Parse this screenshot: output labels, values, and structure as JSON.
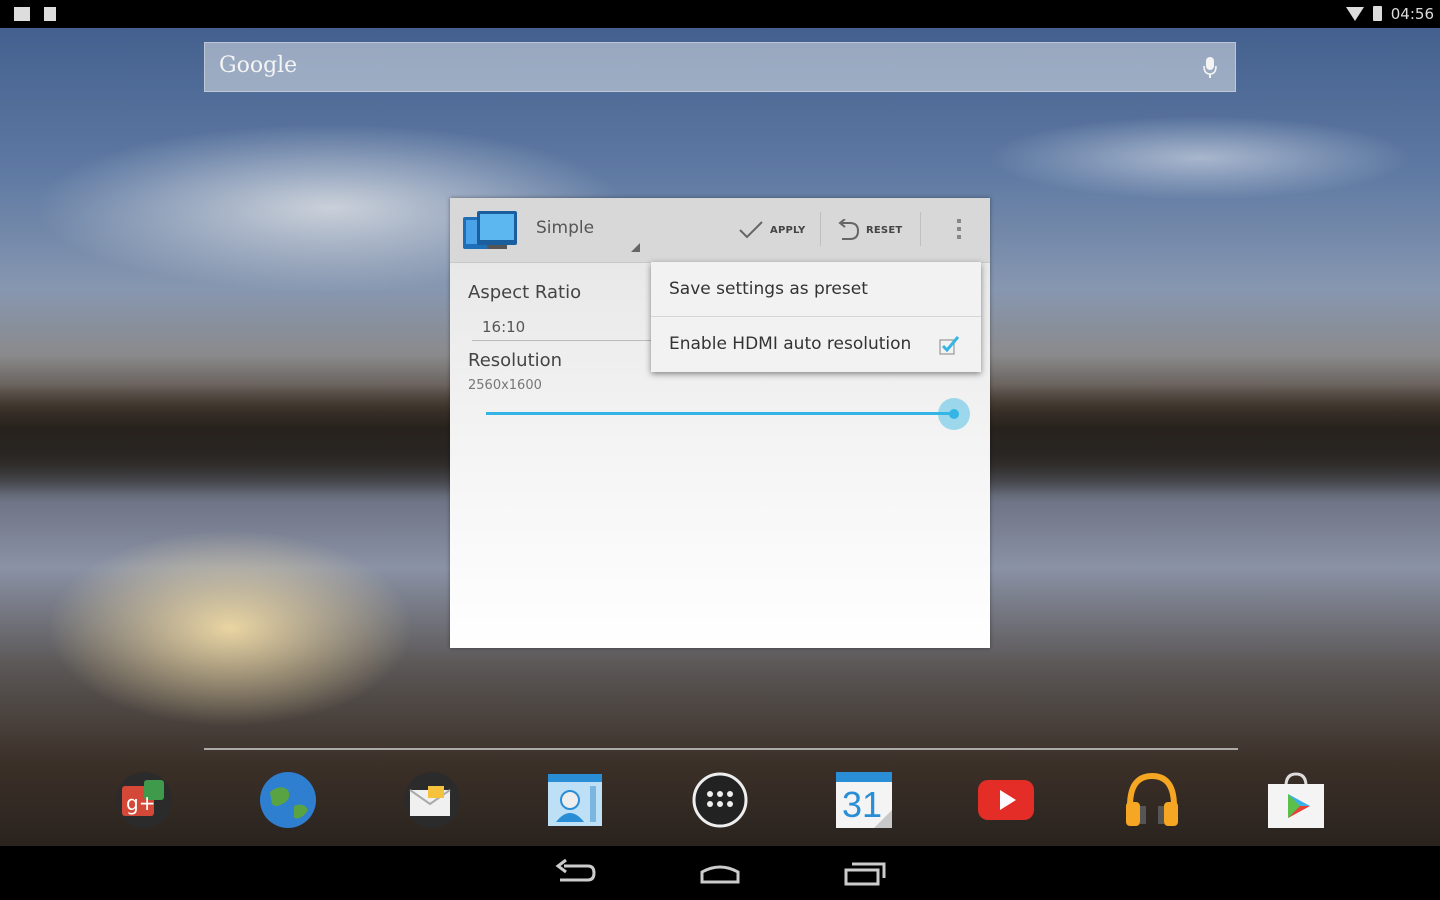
{
  "status_bar": {
    "time": "04:56"
  },
  "search": {
    "brand": "Google"
  },
  "widget": {
    "mode": "Simple",
    "apply_label": "APPLY",
    "reset_label": "RESET",
    "aspect_ratio_label": "Aspect Ratio",
    "aspect_ratio_value": "16:10",
    "resolution_label": "Resolution",
    "resolution_value": "2560x1600",
    "resolution_slider_level": 1.0
  },
  "menu": {
    "items": [
      {
        "label": "Save settings as preset"
      },
      {
        "label": "Enable HDMI auto resolution",
        "checked": true
      }
    ]
  },
  "dock": {
    "apps": [
      "google-plus-icon",
      "browser-globe-icon",
      "email-icon",
      "contacts-icon",
      "app-drawer-icon",
      "calendar-icon",
      "youtube-icon",
      "play-music-icon",
      "play-store-icon"
    ],
    "calendar_day": "31"
  },
  "colors": {
    "accent": "#34b5e5",
    "youtube_red": "#e52d27"
  }
}
